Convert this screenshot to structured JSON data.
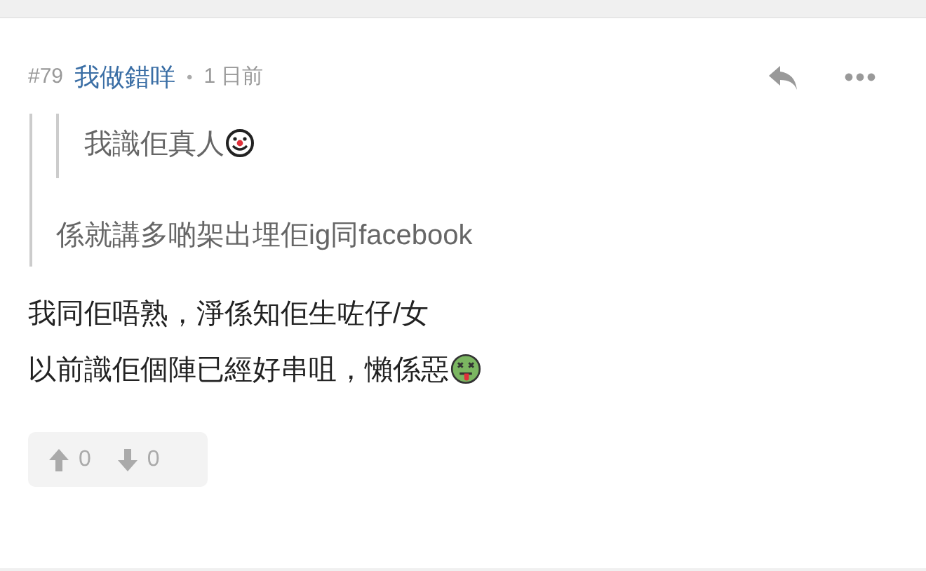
{
  "post": {
    "number": "#79",
    "author": "我做錯咩",
    "separator": "•",
    "time": "1 日前"
  },
  "quote": {
    "nested_quote": {
      "text": "我識佢真人"
    },
    "text": "係就講多啲架出埋佢ig同facebook"
  },
  "body": {
    "lines": [
      "我同佢唔熟，淨係知佢生咗仔/女",
      "以前識佢個陣已經好串咀，懶係惡"
    ]
  },
  "votes": {
    "up": "0",
    "down": "0"
  }
}
